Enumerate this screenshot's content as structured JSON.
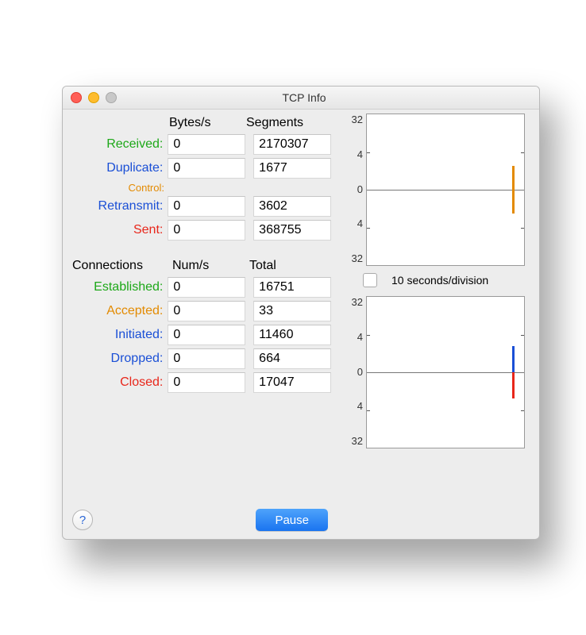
{
  "window": {
    "title": "TCP Info"
  },
  "headers": {
    "bytesPerSec": "Bytes/s",
    "segments": "Segments",
    "connections": "Connections",
    "numPerSec": "Num/s",
    "total": "Total"
  },
  "labels": {
    "received": "Received:",
    "duplicate": "Duplicate:",
    "control": "Control:",
    "retransmit": "Retransmit:",
    "sent": "Sent:",
    "established": "Established:",
    "accepted": "Accepted:",
    "initiated": "Initiated:",
    "dropped": "Dropped:",
    "closed": "Closed:"
  },
  "values": {
    "received": {
      "rate": "0",
      "segments": "2170307"
    },
    "duplicate": {
      "rate": "0",
      "segments": "1677"
    },
    "retransmit": {
      "rate": "0",
      "segments": "3602"
    },
    "sent": {
      "rate": "0",
      "segments": "368755"
    },
    "established": {
      "rate": "0",
      "total": "16751"
    },
    "accepted": {
      "rate": "0",
      "total": "33"
    },
    "initiated": {
      "rate": "0",
      "total": "11460"
    },
    "dropped": {
      "rate": "0",
      "total": "664"
    },
    "closed": {
      "rate": "0",
      "total": "17047"
    }
  },
  "buttons": {
    "pause": "Pause"
  },
  "chart": {
    "yticks": [
      "32",
      "4",
      "0",
      "4",
      "32"
    ],
    "caption": "10 seconds/division",
    "checkbox_checked": false
  },
  "colors": {
    "green": "#1da818",
    "blue": "#1a4fd6",
    "orange": "#e38a00",
    "red": "#e8261a",
    "accent": "#1a74f0"
  },
  "chart_data": [
    {
      "type": "line",
      "title": "",
      "xlabel": "",
      "ylabel": "",
      "ylim": [
        -32,
        32
      ],
      "yticks": [
        -32,
        -4,
        0,
        4,
        32
      ],
      "x_divisions_seconds": 10,
      "series": [
        {
          "name": "orange-spike",
          "color": "#e38a00",
          "x": [
            1
          ],
          "y_top": [
            6
          ],
          "y_bottom": [
            -6
          ]
        }
      ]
    },
    {
      "type": "line",
      "title": "",
      "xlabel": "",
      "ylabel": "",
      "ylim": [
        -32,
        32
      ],
      "yticks": [
        -32,
        -4,
        0,
        4,
        32
      ],
      "x_divisions_seconds": 10,
      "series": [
        {
          "name": "blue-spike",
          "color": "#1a4fd6",
          "x": [
            1
          ],
          "y_top": [
            7
          ],
          "y_bottom": [
            0
          ]
        },
        {
          "name": "red-spike",
          "color": "#e8261a",
          "x": [
            1
          ],
          "y_top": [
            0
          ],
          "y_bottom": [
            -7
          ]
        }
      ]
    }
  ]
}
